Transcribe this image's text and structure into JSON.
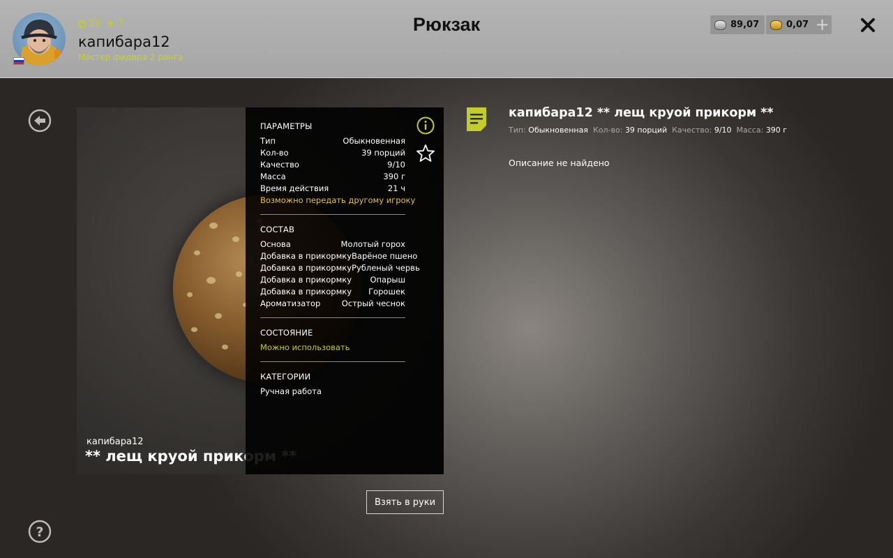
{
  "header": {
    "title": "Рюкзак",
    "username": "капибара12",
    "rank": "Мастер фидера 2 ранга",
    "level": "26",
    "stars": "7",
    "silver": "89,07",
    "gold": "0,07",
    "plus_label": "+"
  },
  "item": {
    "owner": "капибара12",
    "name": "** лещ круой прикорм **",
    "full_title": "капибара12 ** лещ круой прикорм **"
  },
  "params": {
    "section_title": "ПАРАМЕТРЫ",
    "rows": [
      {
        "k": "Тип",
        "v": "Обыкновенная"
      },
      {
        "k": "Кол-во",
        "v": "39 порций"
      },
      {
        "k": "Качество",
        "v": "9/10"
      },
      {
        "k": "Масса",
        "v": "390 г"
      },
      {
        "k": "Время действия",
        "v": "21 ч"
      }
    ],
    "transfer_note": "Возможно передать другому игроку"
  },
  "composition": {
    "section_title": "СОСТАВ",
    "rows": [
      {
        "k": "Основа",
        "v": "Молотый горох"
      },
      {
        "k": "Добавка в прикормку",
        "v": "Варёное пшено"
      },
      {
        "k": "Добавка в прикормку",
        "v": "Рубленый червь"
      },
      {
        "k": "Добавка в прикормку",
        "v": "Опарыш"
      },
      {
        "k": "Добавка в прикормку",
        "v": "Горошек"
      },
      {
        "k": "Ароматизатор",
        "v": "Острый чеснок"
      }
    ]
  },
  "state": {
    "section_title": "СОСТОЯНИЕ",
    "value": "Можно использовать"
  },
  "categories": {
    "section_title": "КАТЕГОРИИ",
    "value": "Ручная работа"
  },
  "description": {
    "meta": [
      {
        "label": "Тип:",
        "value": "Обыкновенная"
      },
      {
        "label": "Кол-во:",
        "value": "39 порций"
      },
      {
        "label": "Качество:",
        "value": "9/10"
      },
      {
        "label": "Масса:",
        "value": "390 г"
      }
    ],
    "text": "Описание не найдено"
  },
  "actions": {
    "take_label": "Взять в руки"
  },
  "colors": {
    "accent": "#c2cd2c",
    "transfer": "#e4c23b",
    "header_bg": "#ababab"
  }
}
